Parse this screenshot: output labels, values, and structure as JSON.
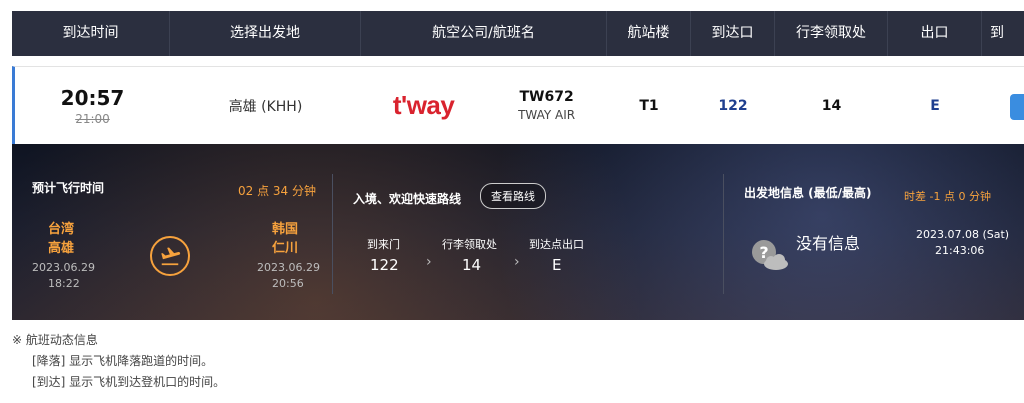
{
  "header": {
    "columns": [
      "到达时间",
      "选择出发地",
      "航空公司/航班名",
      "航站楼",
      "到达口",
      "行李领取处",
      "出口",
      "到"
    ]
  },
  "flight": {
    "arrival_time": "20:57",
    "scheduled_time": "21:00",
    "departure": "高雄 (KHH)",
    "airline_logo": "t'way",
    "flight_no": "TW672",
    "airline_name": "TWAY AIR",
    "terminal": "T1",
    "gate": "122",
    "baggage": "14",
    "exit": "E"
  },
  "detail": {
    "duration_label": "预计飞行时间",
    "duration": "02 点 34 分钟",
    "origin_country": "台湾",
    "origin_city": "高雄",
    "origin_date": "2023.06.29",
    "origin_time": "18:22",
    "dest_country": "韩国",
    "dest_city": "仁川",
    "dest_date": "2023.06.29",
    "dest_time": "20:56",
    "route_title": "入境、欢迎快速路线",
    "route_button": "查看路线",
    "route_gate_label": "到来门",
    "route_gate": "122",
    "route_belt_label": "行李领取处",
    "route_belt": "14",
    "route_exit_label": "到达点出口",
    "route_exit": "E",
    "weather_title": "出发地信息 (最低/最高)",
    "time_diff": "时差  -1 点  0 分钟",
    "no_info": "没有信息",
    "local_date": "2023.07.08 (Sat)",
    "local_time": "21:43:06"
  },
  "notes": {
    "title": "※ 航班动态信息",
    "line1": "[降落] 显示飞机降落跑道的时间。",
    "line2": "[到达] 显示飞机到达登机口的时间。"
  },
  "colors": {
    "header_bg": "#2b2f3f",
    "accent_orange": "#f7a23d",
    "accent_blue": "#1f3f8f",
    "brand_red": "#d9232e"
  }
}
